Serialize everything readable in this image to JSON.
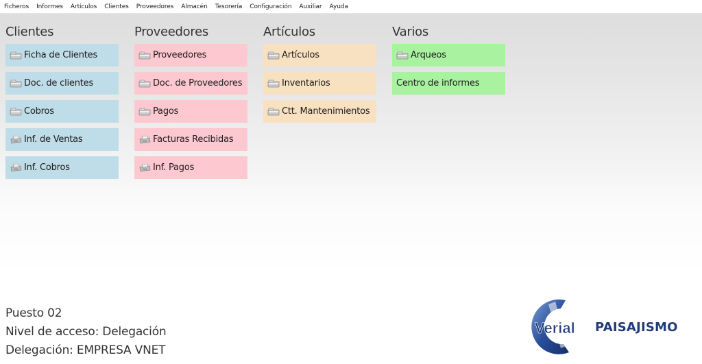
{
  "menu": [
    "Ficheros",
    "Informes",
    "Artículos",
    "Clientes",
    "Proveedores",
    "Almacén",
    "Tesorería",
    "Configuración",
    "Auxiliar",
    "Ayuda"
  ],
  "columns": {
    "clientes": {
      "title": "Clientes",
      "items": [
        {
          "label": "Ficha de Clientes",
          "icon": "folder-icon"
        },
        {
          "label": "Doc. de clientes",
          "icon": "folder-icon"
        },
        {
          "label": "Cobros",
          "icon": "folder-icon"
        },
        {
          "label": "Inf. de Ventas",
          "icon": "printer-icon"
        },
        {
          "label": "Inf. Cobros",
          "icon": "printer-icon"
        }
      ]
    },
    "proveedores": {
      "title": "Proveedores",
      "items": [
        {
          "label": "Proveedores",
          "icon": "folder-icon"
        },
        {
          "label": "Doc. de Proveedores",
          "icon": "folder-icon"
        },
        {
          "label": "Pagos",
          "icon": "folder-icon"
        },
        {
          "label": "Facturas Recibidas",
          "icon": "printer-icon"
        },
        {
          "label": "Inf. Pagos",
          "icon": "printer-icon"
        }
      ]
    },
    "articulos": {
      "title": "Artículos",
      "items": [
        {
          "label": "Artículos",
          "icon": "folder-icon"
        },
        {
          "label": "Inventarios",
          "icon": "folder-icon"
        },
        {
          "label": "Ctt. Mantenimientos",
          "icon": "folder-icon"
        }
      ]
    },
    "varios": {
      "title": "Varios",
      "items": [
        {
          "label": "Arqueos",
          "icon": "folder-icon"
        },
        {
          "label": "Centro de informes",
          "icon": ""
        }
      ]
    }
  },
  "colors": {
    "clientes": "#bfdde8",
    "proveedores": "#fdc8d0",
    "articulos": "#f8e1c0",
    "varios": "#a8f2a0",
    "brand": "#1f3b78"
  },
  "status": {
    "puesto": "Puesto 02",
    "nivel": "Nivel de acceso: Delegación",
    "delegacion": "Delegación: EMPRESA VNET"
  },
  "logos": {
    "verial_text": "Verial",
    "company": "PAISAJISMO"
  }
}
